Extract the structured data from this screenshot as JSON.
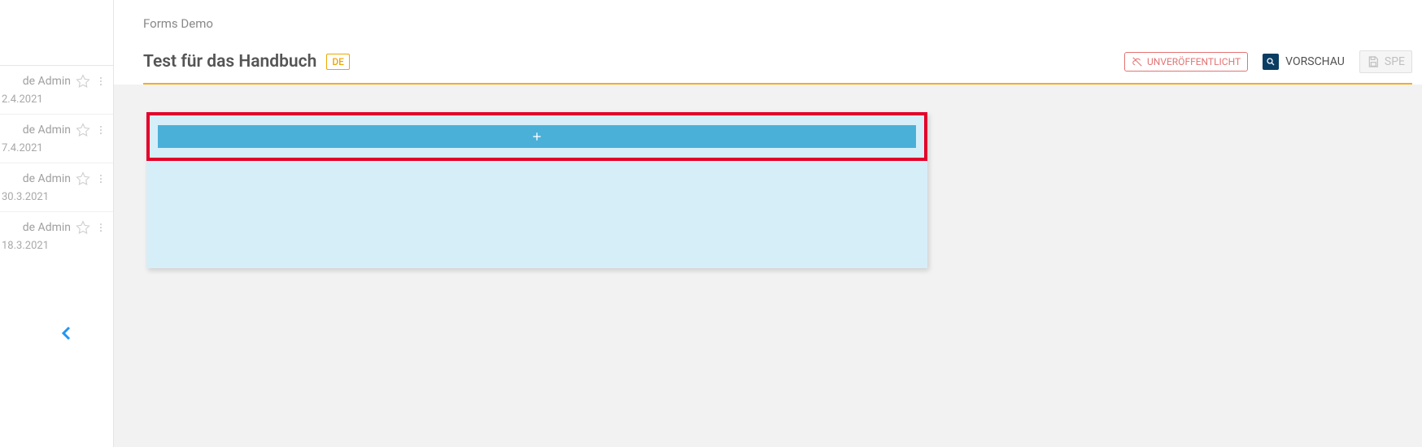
{
  "sidebar": {
    "items": [
      {
        "title_suffix": "de Admin",
        "date": "2.4.2021"
      },
      {
        "title_suffix": "de Admin",
        "date": "7.4.2021"
      },
      {
        "title_suffix": "de Admin",
        "date": "30.3.2021"
      },
      {
        "title_suffix": "de Admin",
        "date": "18.3.2021"
      }
    ]
  },
  "header": {
    "breadcrumb": "Forms Demo",
    "title": "Test für das Handbuch",
    "lang_badge": "DE",
    "status_label": "UNVERÖFFENTLICHT",
    "preview_label": "VORSCHAU",
    "save_label": "SPE"
  }
}
